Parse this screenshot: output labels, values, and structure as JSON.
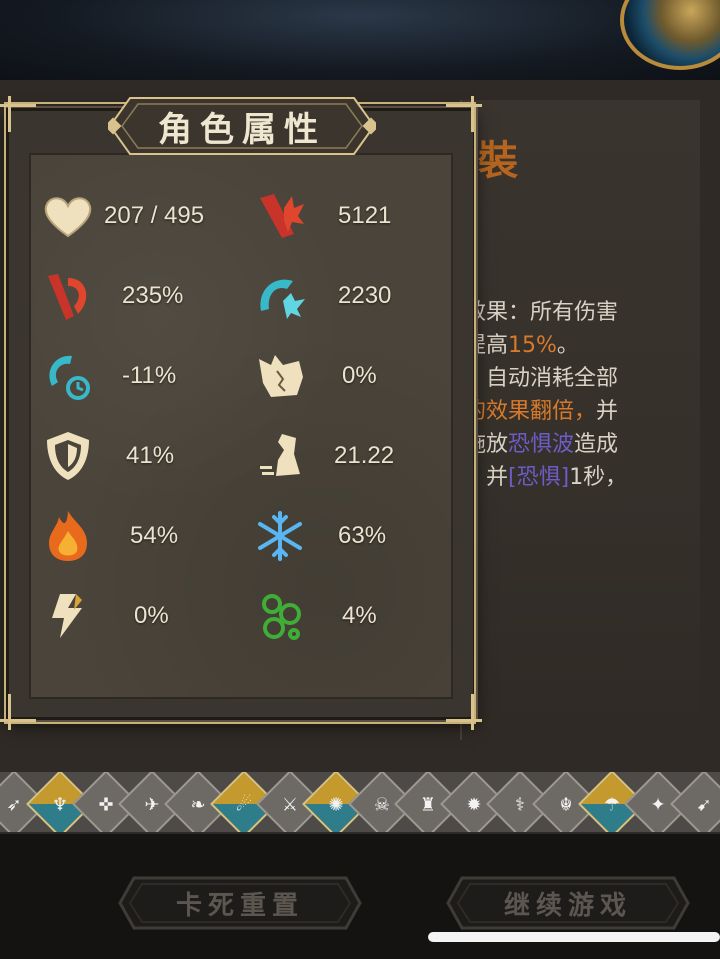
{
  "panel": {
    "title": "角色属性",
    "stats": [
      {
        "icon": "heart-icon",
        "value": "207 / 495"
      },
      {
        "icon": "attack-power-icon",
        "value": "5121"
      },
      {
        "icon": "crit-damage-icon",
        "value": "235%"
      },
      {
        "icon": "skill-damage-icon",
        "value": "2230"
      },
      {
        "icon": "cooldown-icon",
        "value": "-11%"
      },
      {
        "icon": "dodge-icon",
        "value": "0%"
      },
      {
        "icon": "shield-icon",
        "value": "41%"
      },
      {
        "icon": "move-speed-icon",
        "value": "21.22"
      },
      {
        "icon": "fire-icon",
        "value": "54%"
      },
      {
        "icon": "snowflake-icon",
        "value": "63%"
      },
      {
        "icon": "lightning-icon",
        "value": "0%"
      },
      {
        "icon": "poison-icon",
        "value": "4%"
      }
    ]
  },
  "background": {
    "title_fragment": "裝",
    "desc": {
      "l1": "效果：所有伤害",
      "l2a": "提高",
      "l2b": "15%",
      "l2c": "。",
      "l3a": "：",
      "l3b": "自动消耗全部",
      "l4a": "的效果翻倍，",
      "l4b": "并",
      "l5a": "施放",
      "l5b": "恐惧波",
      "l5c": "造成",
      "l6a": "，并",
      "l6b": "[恐惧]",
      "l6c": "1秒，"
    }
  },
  "buttons": {
    "reset": "卡死重置",
    "continue": "继续游戏"
  },
  "colors": {
    "accent_gold": "#d8c38c",
    "highlight_orange": "#d87a2a",
    "highlight_purple": "#6c5cc6"
  }
}
